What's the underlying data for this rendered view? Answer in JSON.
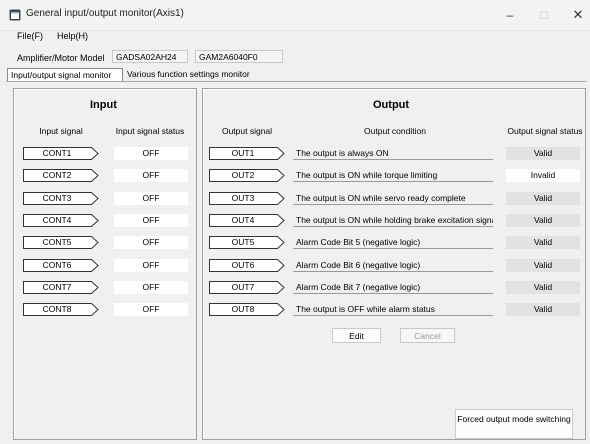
{
  "window": {
    "title": "General input/output monitor(Axis1)",
    "icon": "app-window-icon",
    "minimize": "–",
    "maximize": "□",
    "close": "✕"
  },
  "menu": [
    {
      "label": "File(F)"
    },
    {
      "label": "Help(H)"
    }
  ],
  "model": {
    "label": "Amplifier/Motor Model",
    "amplifier": "GADSA02AH24",
    "motor": "GAM2A6040F0"
  },
  "tabs": [
    {
      "label": "Input/output signal monitor",
      "active": true
    },
    {
      "label": "Various function settings monitor",
      "active": false
    }
  ],
  "input": {
    "title": "Input",
    "col_signal": "Input signal",
    "col_status": "Input signal status",
    "rows": [
      {
        "signal": "CONT1",
        "status": "OFF"
      },
      {
        "signal": "CONT2",
        "status": "OFF"
      },
      {
        "signal": "CONT3",
        "status": "OFF"
      },
      {
        "signal": "CONT4",
        "status": "OFF"
      },
      {
        "signal": "CONT5",
        "status": "OFF"
      },
      {
        "signal": "CONT6",
        "status": "OFF"
      },
      {
        "signal": "CONT7",
        "status": "OFF"
      },
      {
        "signal": "CONT8",
        "status": "OFF"
      }
    ]
  },
  "output": {
    "title": "Output",
    "col_signal": "Output signal",
    "col_condition": "Output condition",
    "col_status": "Output signal status",
    "rows": [
      {
        "signal": "OUT1",
        "condition": "The output is always ON",
        "status": "Valid"
      },
      {
        "signal": "OUT2",
        "condition": "The output is ON while torque limiting",
        "status": "Invalid"
      },
      {
        "signal": "OUT3",
        "condition": "The output is ON while servo ready complete",
        "status": "Valid"
      },
      {
        "signal": "OUT4",
        "condition": "The output is ON while holding brake excitation signal",
        "status": "Valid"
      },
      {
        "signal": "OUT5",
        "condition": "Alarm Code Bit 5 (negative logic)",
        "status": "Valid"
      },
      {
        "signal": "OUT6",
        "condition": "Alarm Code Bit 6 (negative logic)",
        "status": "Valid"
      },
      {
        "signal": "OUT7",
        "condition": "Alarm Code Bit 7 (negative logic)",
        "status": "Valid"
      },
      {
        "signal": "OUT8",
        "condition": "The output is OFF while alarm status",
        "status": "Valid"
      }
    ],
    "edit_label": "Edit",
    "cancel_label": "Cancel",
    "forced_label": "Forced output mode switching"
  },
  "colors": {
    "valid_bg": "#e2e2e2",
    "invalid_bg": "#ffffff",
    "panel_border": "#a0a0a0"
  }
}
